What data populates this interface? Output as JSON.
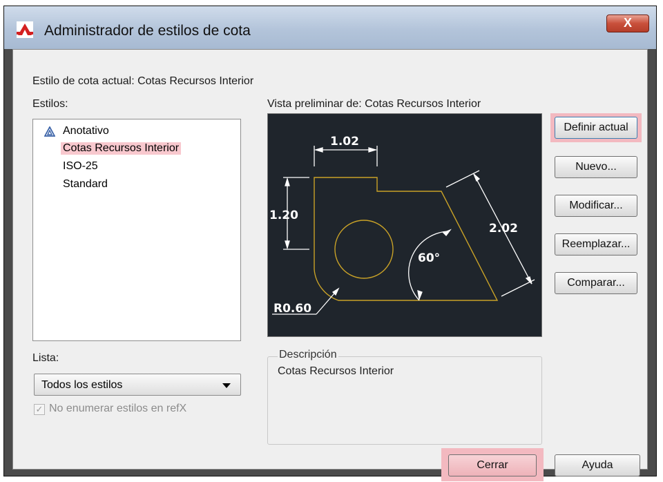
{
  "window": {
    "title": "Administrador de estilos de cota",
    "close_label": "X"
  },
  "current_style": "Estilo de cota actual: Cotas Recursos Interior",
  "styles": {
    "label": "Estilos:",
    "items": [
      {
        "label": "Anotativo",
        "icon": "annotative-icon"
      },
      {
        "label": "Cotas Recursos Interior",
        "selected": true
      },
      {
        "label": "ISO-25"
      },
      {
        "label": "Standard"
      }
    ]
  },
  "list_filter": {
    "label": "Lista:",
    "value": "Todos los estilos"
  },
  "xref_checkbox": {
    "label": "No enumerar estilos en refX",
    "checked": true,
    "disabled": true
  },
  "preview": {
    "label": "Vista preliminar de: Cotas Recursos Interior",
    "dims": {
      "top": "1.02",
      "left": "1.20",
      "diag": "2.02",
      "angle": "60°",
      "radius": "R0.60"
    }
  },
  "description": {
    "label": "Descripción",
    "value": "Cotas Recursos Interior"
  },
  "buttons": {
    "set_current": "Definir actual",
    "new": "Nuevo...",
    "modify": "Modificar...",
    "override": "Reemplazar...",
    "compare": "Comparar...",
    "close": "Cerrar",
    "help": "Ayuda"
  },
  "colors": {
    "highlight": "#f3b9c0",
    "preview_bg": "#1f252c",
    "geometry": "#c9a227",
    "dimension": "#ffffff"
  }
}
